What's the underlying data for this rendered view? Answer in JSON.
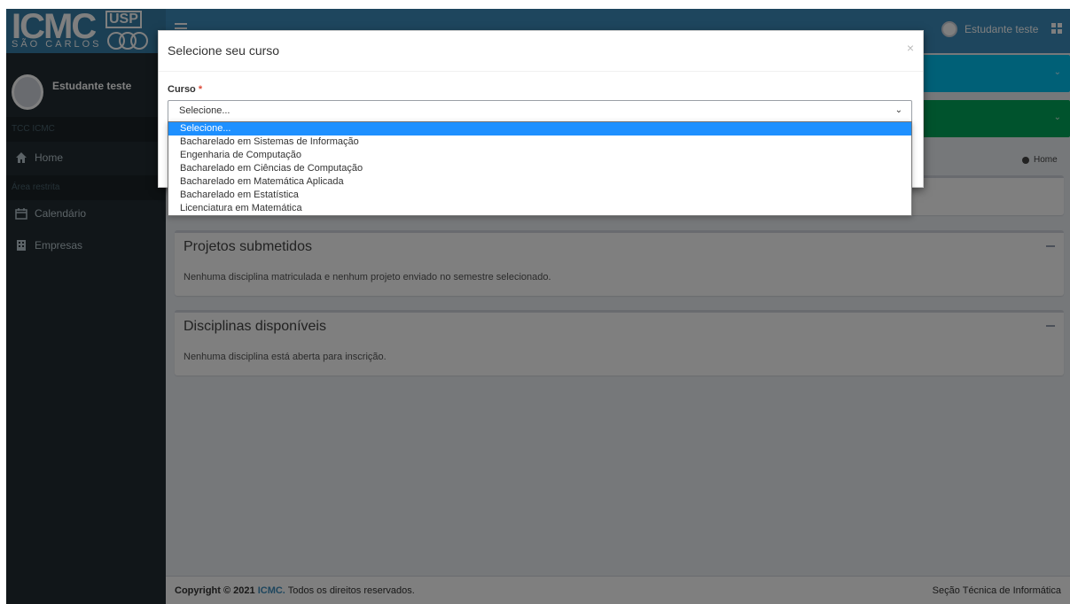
{
  "sidebar": {
    "logo": {
      "main": "ICMC",
      "usp": "USP",
      "city": "SÃO CARLOS"
    },
    "user_name": "Estudante teste",
    "section_1": "TCC ICMC",
    "home": "Home",
    "section_2": "Área restrita",
    "calendar": "Calendário",
    "companies": "Empresas"
  },
  "header": {
    "user_name": "Estudante teste"
  },
  "breadcrumb": {
    "home": "Home"
  },
  "boxes": {
    "submitted": {
      "title": "Projetos submetidos",
      "body": "Nenhuma disciplina matriculada e nenhum projeto enviado no semestre selecionado."
    },
    "available": {
      "title": "Disciplinas disponíveis",
      "body": "Nenhuma disciplina está aberta para inscrição."
    }
  },
  "footer": {
    "copyright": "Copyright © 2021",
    "brand": "ICMC.",
    "rights": "Todos os direitos reservados.",
    "right": "Seção Técnica de Informática"
  },
  "modal": {
    "title": "Selecione seu curso",
    "close": "×",
    "field_label": "Curso",
    "required_mark": "*",
    "select_value": "Selecione...",
    "options": [
      "Selecione...",
      "Bacharelado em Sistemas de Informação",
      "Engenharia de Computação",
      "Bacharelado em Ciências de Computação",
      "Bacharelado em Matemática Aplicada",
      "Bacharelado em Estatística",
      "Licenciatura em Matemática"
    ]
  },
  "colors": {
    "primary": "#3c8dbc",
    "info_aqua": "#00c0ef",
    "success_green": "#00a65a",
    "highlight": "#1e90ff"
  }
}
